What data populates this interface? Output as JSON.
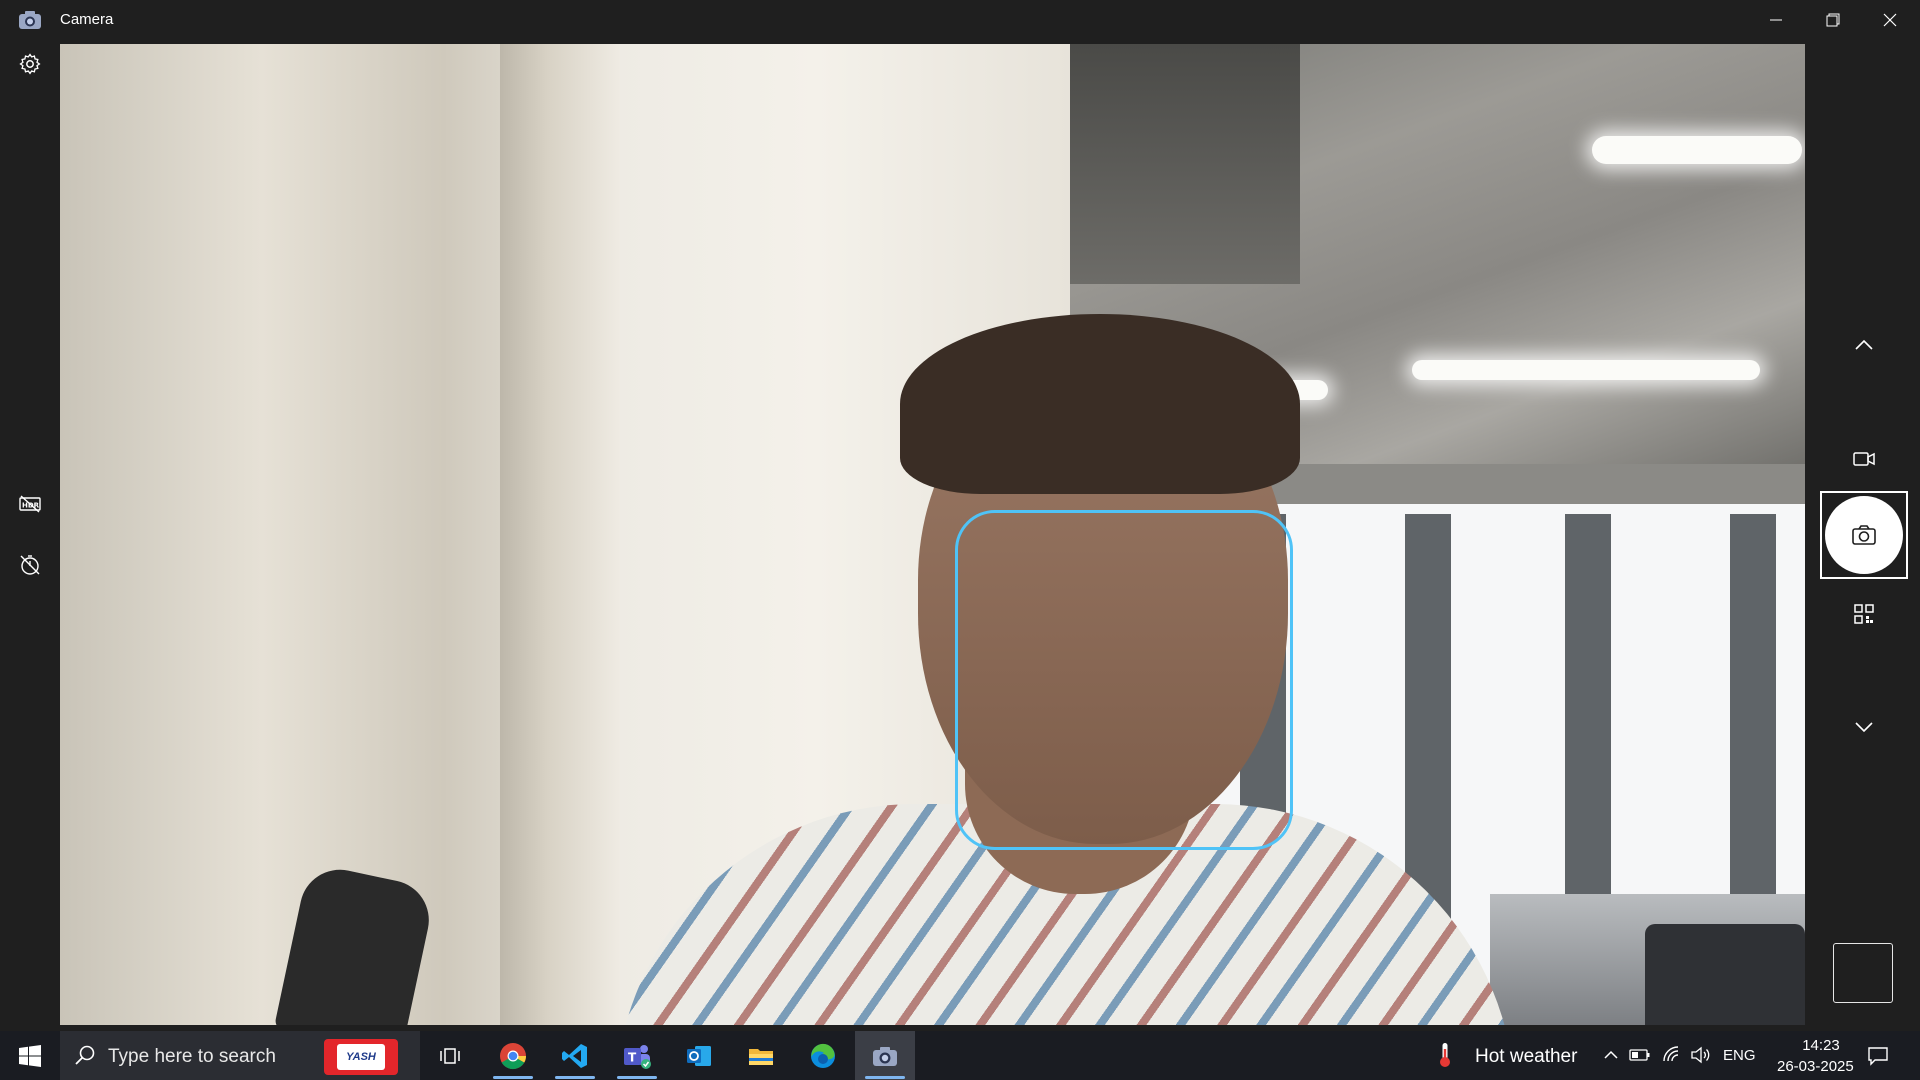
{
  "window": {
    "title": "Camera",
    "controls": {
      "minimize": "minimize",
      "maximize": "restore",
      "close": "close"
    }
  },
  "left_toolbar": {
    "items": [
      {
        "icon": "gear-icon",
        "label": "Settings"
      },
      {
        "icon": "hdr-off-icon",
        "label": "HDR off"
      },
      {
        "icon": "timer-off-icon",
        "label": "Timer off"
      }
    ]
  },
  "viewfinder": {
    "face_detection_color": "#4fc3f7"
  },
  "right_toolbar": {
    "modes": [
      {
        "icon": "chevron-up-icon"
      },
      {
        "icon": "video-icon"
      },
      {
        "icon": "camera-icon",
        "selected": true
      },
      {
        "icon": "qr-code-icon"
      },
      {
        "icon": "chevron-down-icon"
      }
    ]
  },
  "taskbar": {
    "search_placeholder": "Type here to search",
    "search_badge": "YASH",
    "pinned_apps": [
      {
        "icon": "task-view-icon"
      },
      {
        "icon": "chrome-icon"
      },
      {
        "icon": "vscode-icon"
      },
      {
        "icon": "teams-icon"
      },
      {
        "icon": "outlook-icon"
      },
      {
        "icon": "file-explorer-icon"
      },
      {
        "icon": "edge-icon"
      },
      {
        "icon": "camera-app-icon",
        "active": true
      }
    ],
    "weather": "Hot weather",
    "language": "ENG",
    "time": "14:23",
    "date": "26-03-2025"
  }
}
